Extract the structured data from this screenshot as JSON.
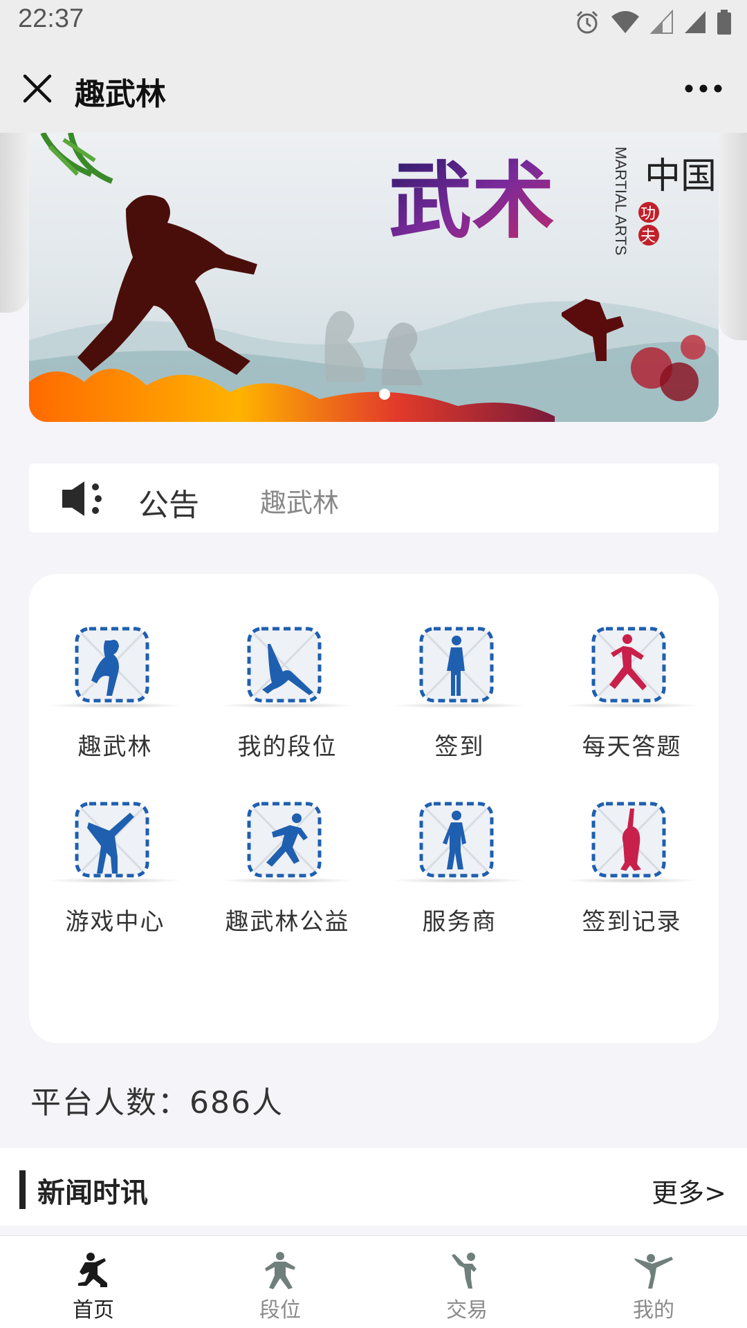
{
  "status_bar": {
    "time": "22:37"
  },
  "header": {
    "title": "趣武林"
  },
  "banner": {
    "title_text": "武术",
    "side_text": "MARTIAL ARTS",
    "corner_text": "中国",
    "seal_1": "功",
    "seal_2": "夫"
  },
  "notice": {
    "label": "公告",
    "text": "趣武林"
  },
  "grid": {
    "items": [
      {
        "label": "趣武林",
        "icon": "dancer-icon",
        "color": "#1f5fb0"
      },
      {
        "label": "我的段位",
        "icon": "stretch-icon",
        "color": "#1f5fb0"
      },
      {
        "label": "签到",
        "icon": "standing-man-icon",
        "color": "#1f5fb0"
      },
      {
        "label": "每天答题",
        "icon": "runner-icon",
        "color": "#c8204b"
      },
      {
        "label": "游戏中心",
        "icon": "high-kick-icon",
        "color": "#1f5fb0"
      },
      {
        "label": "趣武林公益",
        "icon": "sprinter-icon",
        "color": "#1f5fb0"
      },
      {
        "label": "服务商",
        "icon": "walking-man-icon",
        "color": "#1f5fb0"
      },
      {
        "label": "签到记录",
        "icon": "gymnast-icon",
        "color": "#c8204b"
      }
    ]
  },
  "platform": {
    "count_text": "平台人数：686人"
  },
  "news": {
    "title": "新闻时讯",
    "more": "更多>"
  },
  "tabs": [
    {
      "label": "首页",
      "icon": "martial-artist-icon",
      "active": true
    },
    {
      "label": "段位",
      "icon": "stance-icon",
      "active": false
    },
    {
      "label": "交易",
      "icon": "kick-icon",
      "active": false
    },
    {
      "label": "我的",
      "icon": "flying-kick-icon",
      "active": false
    }
  ]
}
